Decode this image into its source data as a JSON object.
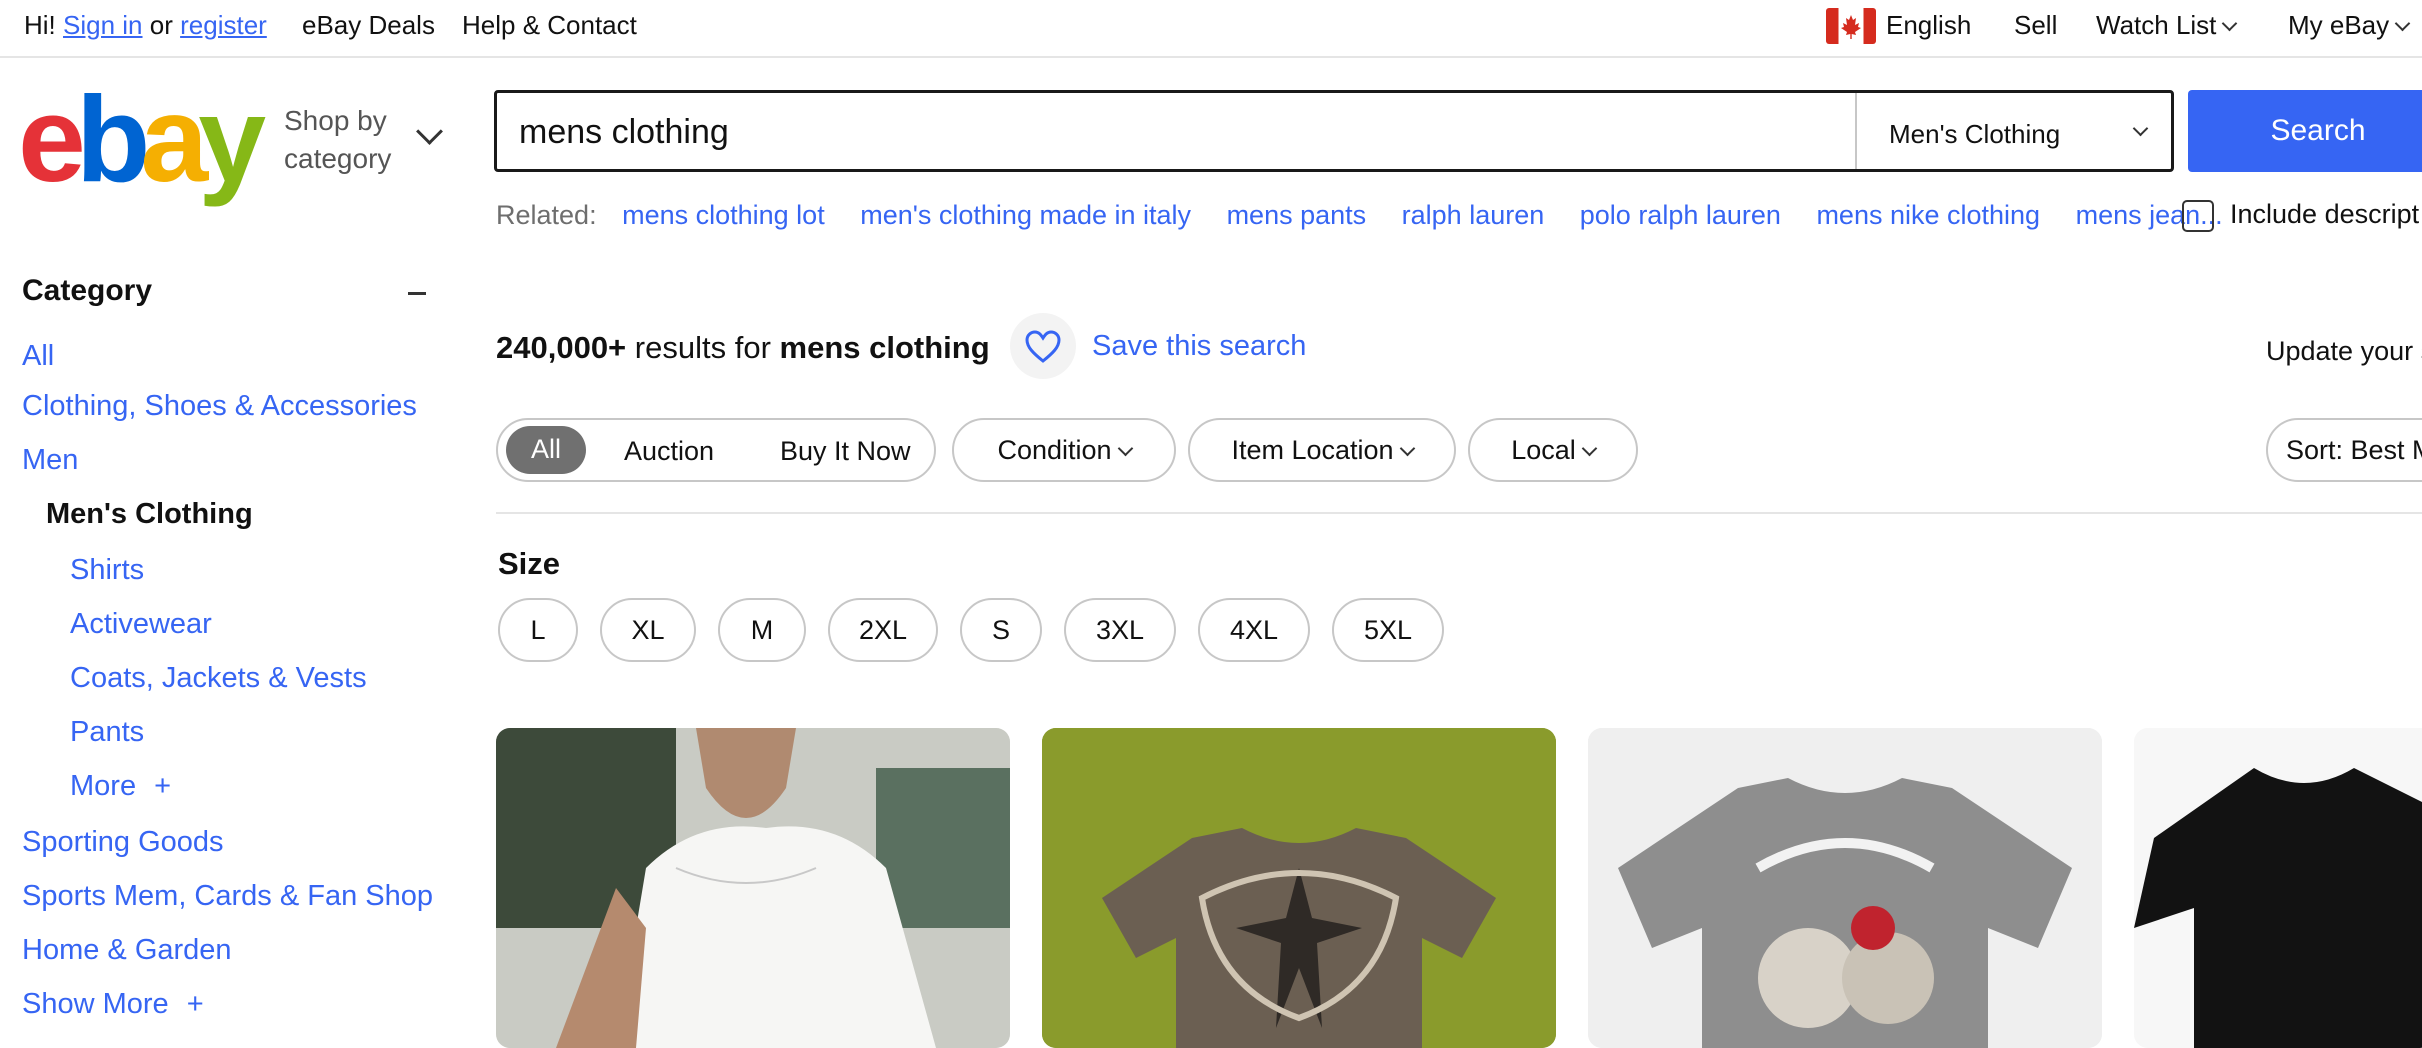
{
  "topbar": {
    "greeting": "Hi!",
    "sign_in": "Sign in",
    "or": "or",
    "register": "register",
    "deals": "eBay Deals",
    "help": "Help & Contact",
    "language": "English",
    "sell": "Sell",
    "watch_list": "Watch List",
    "my_ebay": "My eBay"
  },
  "header": {
    "logo_letters": [
      "e",
      "b",
      "a",
      "y"
    ],
    "logo_colors": [
      "#e53238",
      "#0064d2",
      "#f5af02",
      "#86b817"
    ],
    "shop_by_1": "Shop by",
    "shop_by_2": "category"
  },
  "search": {
    "value": "mens clothing",
    "category": "Men's Clothing",
    "button": "Search"
  },
  "related": {
    "label": "Related:",
    "links": [
      "mens clothing lot",
      "men's clothing made in italy",
      "mens pants",
      "ralph lauren",
      "polo ralph lauren",
      "mens nike clothing",
      "mens jean..."
    ],
    "include_description": "Include descript"
  },
  "sidebar": {
    "heading": "Category",
    "collapse": "−",
    "items": [
      "All",
      "Clothing, Shoes & Accessories",
      "Men",
      "Men's Clothing",
      "Shirts",
      "Activewear",
      "Coats, Jackets & Vests",
      "Pants",
      "More",
      "Sporting Goods",
      "Sports Mem, Cards & Fan Shop",
      "Home & Garden",
      "Show More"
    ],
    "plus": "+"
  },
  "results": {
    "count": "240,000+",
    "for_text": "results for",
    "query": "mens clothing",
    "save_search": "Save this search",
    "update": "Update your s"
  },
  "filters": {
    "buying": [
      "All",
      "Auction",
      "Buy It Now"
    ],
    "dropdowns": [
      "Condition",
      "Item Location",
      "Local"
    ],
    "sort": "Sort: Best M"
  },
  "size": {
    "heading": "Size",
    "options": [
      "L",
      "XL",
      "M",
      "2XL",
      "S",
      "3XL",
      "4XL",
      "5XL"
    ]
  },
  "colors": {
    "accent": "#3665f3",
    "border": "#c7c7c7"
  }
}
